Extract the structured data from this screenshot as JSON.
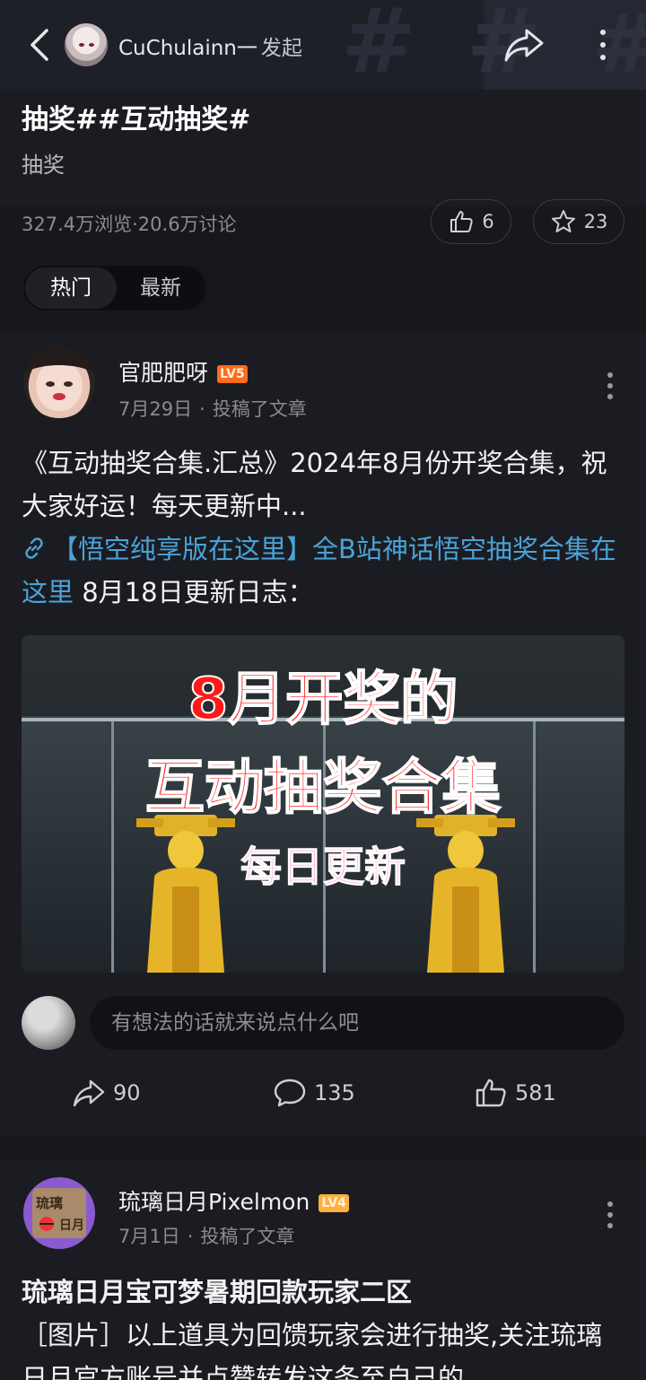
{
  "header": {
    "username": "CuChulainn一",
    "suffix": "发起"
  },
  "topic": {
    "title": "抽奖##互动抽奖#",
    "subtitle": "抽奖",
    "stats": "327.4万浏览·20.6万讨论",
    "like_count": "6",
    "star_count": "23"
  },
  "tabs": [
    "热门",
    "最新"
  ],
  "posts": [
    {
      "author": "官肥肥呀",
      "level": "LV5",
      "date": "7月29日",
      "action": "投稿了文章",
      "text_line": "《互动抽奖合集.汇总》2024年8月份开奖合集，祝大家好运！每天更新中...",
      "link_text": "【悟空纯享版在这里】全B站神话悟空抽奖合集在这里",
      "after_link": " 8月18日更新日志：",
      "image_lines": [
        "8月开奖的",
        "互动抽奖合集",
        "每日更新"
      ],
      "comment_placeholder": "有想法的话就来说点什么吧",
      "shares": "90",
      "comments": "135",
      "likes": "581"
    },
    {
      "author": "琉璃日月Pixelmon",
      "level": "LV4",
      "date": "7月1日",
      "action": "投稿了文章",
      "title": "琉璃日月宝可梦暑期回款玩家二区",
      "body": "［图片］以上道具为回馈玩家会进行抽奖,关注琉璃日月官方账号并点赞转发这条至自己的"
    }
  ],
  "colors": {
    "background": "#17181c",
    "card": "#1b1c21",
    "link": "#4aa3d8",
    "lv5": "#ff6b1a",
    "lv4": "#ffb13b"
  },
  "icons": [
    "back-arrow-icon",
    "share-icon",
    "more-vertical-icon",
    "thumb-up-icon",
    "star-icon",
    "link-icon",
    "comment-icon"
  ]
}
